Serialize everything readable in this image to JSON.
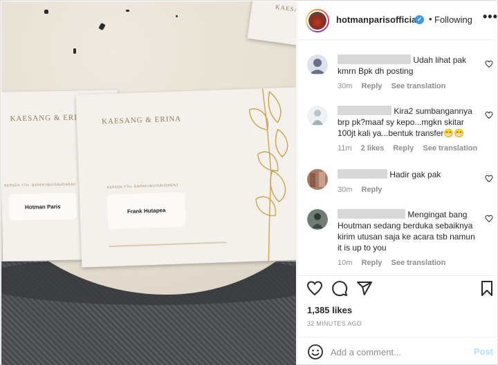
{
  "photo": {
    "card_left": {
      "names": "KAESANG & ERINA",
      "kepada": "KEPADA YTH. BAPAK/IBU/SAUDARA/I",
      "recipient": "Hotman Paris"
    },
    "card_main": {
      "names": "KAESANG & ERINA",
      "kepada": "KEPADA YTH. BAPAK/IBU/SAUDARA/I",
      "recipient": "Frank Hutapea"
    },
    "card_top": {
      "names": "KAESANG"
    }
  },
  "header": {
    "username": "hotmanparisofficial",
    "verified_icon": "verified-badge-icon",
    "separator": "•",
    "follow_status": "Following",
    "more_icon": "more-options-icon"
  },
  "comments": [
    {
      "text": "Udah lihat pak kmrn Bpk dh posting",
      "time": "30m",
      "likes": "",
      "reply": "Reply",
      "translate": "See translation",
      "avatar_color": "#6b6f8a"
    },
    {
      "text": "Kira2 sumbangannya brp pk?maaf sy kepo...mgkn skitar 100jt kali ya...bentuk transfer😁😁",
      "time": "11m",
      "likes": "2 likes",
      "reply": "Reply",
      "translate": "See translation",
      "avatar_color": "#b9c4cf"
    },
    {
      "text": "Hadir gak pak",
      "time": "30m",
      "likes": "",
      "reply": "Reply",
      "translate": "",
      "avatar_color": "#8a5a4a"
    },
    {
      "text": "Mengingat bang Houtman sedang berduka sebaiknya kirim utusan saja ke acara tsb namun it is up to you",
      "time": "10m",
      "likes": "",
      "reply": "Reply",
      "translate": "See translation",
      "avatar_color": "#4a5a52"
    }
  ],
  "actions": {
    "like_icon": "heart-icon",
    "comment_icon": "comment-icon",
    "share_icon": "share-icon",
    "save_icon": "bookmark-icon"
  },
  "likes": "1,385 likes",
  "timestamp": "32 MINUTES AGO",
  "add_comment": {
    "placeholder": "Add a comment...",
    "post_label": "Post",
    "emoji_icon": "emoji-icon"
  },
  "colors": {
    "accent": "#0095f6",
    "post_disabled": "#b2dffc",
    "muted": "#8e8e8e",
    "verified": "#3897f0"
  }
}
